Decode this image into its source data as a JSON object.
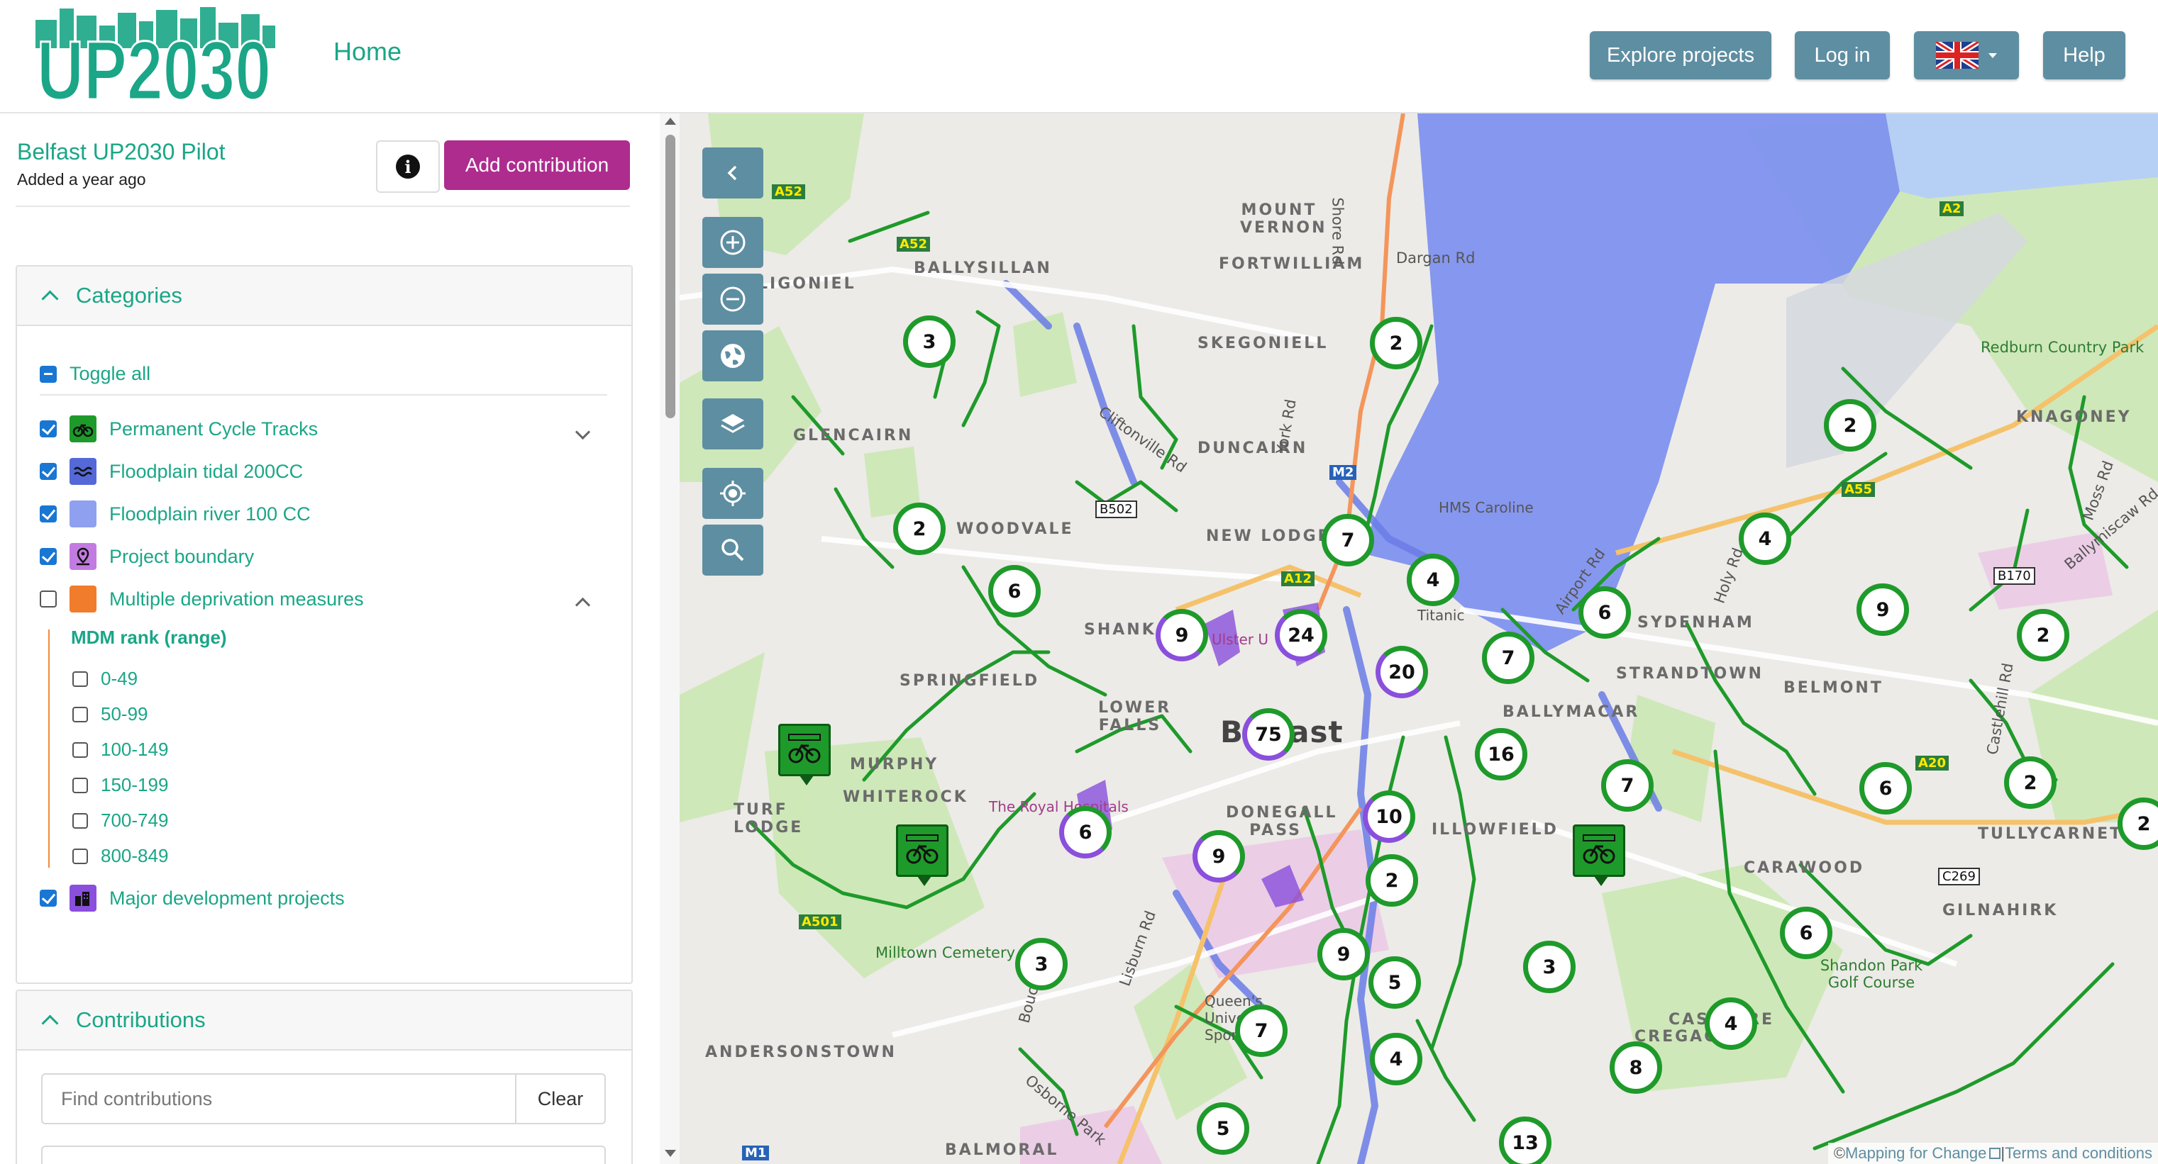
{
  "header": {
    "logo_text": "UP2030",
    "home": "Home",
    "explore": "Explore projects",
    "login": "Log in",
    "language_flag": "uk-flag-icon",
    "help": "Help"
  },
  "project": {
    "title": "Belfast UP2030 Pilot",
    "added": "Added a year ago",
    "add_contribution": "Add contribution"
  },
  "categories": {
    "title": "Categories",
    "toggle_all": "Toggle all",
    "items": [
      {
        "label": "Permanent Cycle Tracks",
        "checked": true,
        "color": "#1e9a2a",
        "icon": "bike-icon"
      },
      {
        "label": "Floodplain tidal 200CC",
        "checked": true,
        "color": "#5468d8",
        "icon": "wave-icon"
      },
      {
        "label": "Floodplain river 100 CC",
        "checked": true,
        "color": "#8fa0f0",
        "icon": "square-icon"
      },
      {
        "label": "Project boundary",
        "checked": true,
        "color": "#c27be0",
        "icon": "map-pin-icon"
      },
      {
        "label": "Multiple deprivation measures",
        "checked": false,
        "color": "#f07c2c",
        "icon": "square-icon"
      },
      {
        "label": "Major development projects",
        "checked": true,
        "color": "#8a4fdc",
        "icon": "buildings-icon"
      }
    ],
    "mdm_title": "MDM rank (range)",
    "mdm_ranges": [
      "0-49",
      "50-99",
      "100-149",
      "150-199",
      "700-749",
      "800-849"
    ]
  },
  "contributions": {
    "title": "Contributions",
    "search_placeholder": "Find contributions",
    "clear": "Clear"
  },
  "map": {
    "labels": {
      "ballysillan": "BALLYSILLAN",
      "ligoniel": "LIGONIEL",
      "glencairn": "GLENCAIRN",
      "woodvale": "WOODVALE",
      "skegoniell": "SKEGONIELL",
      "duncairn": "DUNCAIRN",
      "newlodge": "NEW LODGE",
      "mountvernon": "MOUNT VERNON",
      "fortwilliam": "FORTWILLIAM",
      "shankill": "SHANK",
      "springfield": "SPRINGFIELD",
      "lowerfalls": "LOWER FALLS",
      "murphy": "MURPHY",
      "whiterock": "WHITEROCK",
      "turflodge": "TURF LODGE",
      "donegallpass": "DONEGALL PASS",
      "willowfield": "ILLOWFIELD",
      "ballymacarrett": "BALLYMACAR",
      "sydenham": "SYDENHAM",
      "strandtown": "STRANDTOWN",
      "belmont": "BELMONT",
      "tullycarnet": "TULLYCARNET",
      "gilnahirk": "GILNAHIRK",
      "carawood": "CARAWOOD",
      "castlereagh": "CASTLERE",
      "cregagh": "CREGAGH",
      "andersonstown": "ANDERSONSTOWN",
      "balmoral": "BALMORAL",
      "knagoney": "KNAGONEY",
      "redburn": "Redburn Country Park",
      "shandon": "Shandon Park Golf Course",
      "milltown": "Milltown Cemetery",
      "dargan": "Dargan Rd",
      "shore": "Shore Rd",
      "york": "York Rd",
      "cliftonville": "Cliftonville Rd",
      "airport": "Airport Rd",
      "holy": "Holy Rd",
      "lisburn": "Lisburn Rd",
      "boucher": "Boucher Rd",
      "osborne": "Osborne Park",
      "castlehill": "Castlehill Rd",
      "moss": "Moss Rd",
      "ballymiscaw": "Ballymiscaw Rd",
      "belfast": "Belfast",
      "queens": "Queen's University Sport",
      "royal": "The Royal Hospitals",
      "ulster": "Ulster U",
      "titanic": "Titanic",
      "sscaroline": "HMS Caroline"
    },
    "roads": {
      "a52a": "A52",
      "a52b": "A52",
      "a2": "A2",
      "m2": "M2",
      "b502": "B502",
      "a12": "A12",
      "a55": "A55",
      "b170": "B170",
      "a20": "A20",
      "c269": "C269",
      "a501": "A501",
      "m1": "M1"
    },
    "clusters": [
      "3",
      "2",
      "2",
      "6",
      "7",
      "4",
      "9",
      "24",
      "20",
      "7",
      "6",
      "4",
      "2",
      "9",
      "2",
      "75",
      "16",
      "7",
      "10",
      "6",
      "9",
      "2",
      "6",
      "2",
      "3",
      "9",
      "5",
      "3",
      "6",
      "7",
      "4",
      "4",
      "8",
      "5",
      "13",
      "2"
    ],
    "attribution": {
      "prefix": "© ",
      "link": "Mapping for Change",
      "sep": " | ",
      "terms": "Terms and conditions"
    }
  },
  "colors": {
    "accent": "#1aa687",
    "header_button": "#5e8ea1",
    "add_button": "#ae2c8e",
    "cycle": "#1e9a2a",
    "tidal": "#5468d8",
    "river": "#8fa0f0"
  }
}
